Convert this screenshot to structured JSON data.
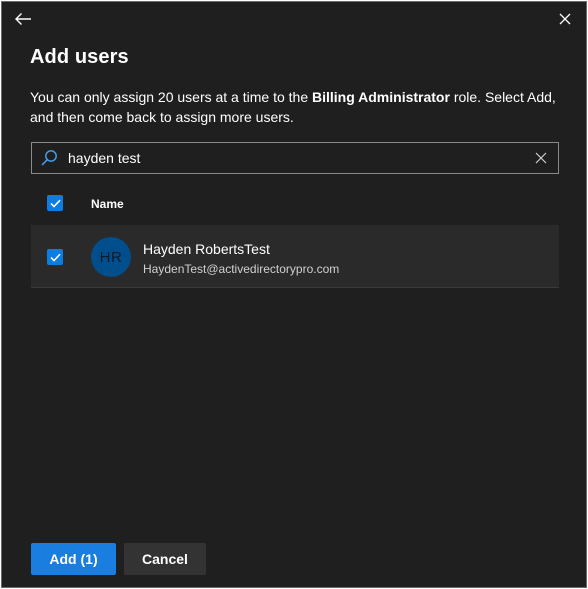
{
  "panel": {
    "title": "Add users",
    "description_prefix": "You can only assign 20 users at a time to the ",
    "description_role": "Billing Administrator",
    "description_suffix": " role. Select Add, and then come back to assign more users."
  },
  "icons": {
    "back": "back-arrow-icon",
    "close": "close-icon",
    "search": "search-icon",
    "clear": "clear-icon",
    "check": "checkmark-icon"
  },
  "search": {
    "value": "hayden test"
  },
  "table": {
    "column_name": "Name",
    "select_all_checked": true,
    "rows": [
      {
        "checked": true,
        "initials": "HR",
        "name": "Hayden RobertsTest",
        "email": "HaydenTest@activedirectorypro.com"
      }
    ]
  },
  "footer": {
    "add_label": "Add (1)",
    "cancel_label": "Cancel"
  },
  "colors": {
    "background": "#1f1f1f",
    "accent": "#1a7de0",
    "avatar": "#004e8c",
    "row": "#2a2a2a"
  }
}
